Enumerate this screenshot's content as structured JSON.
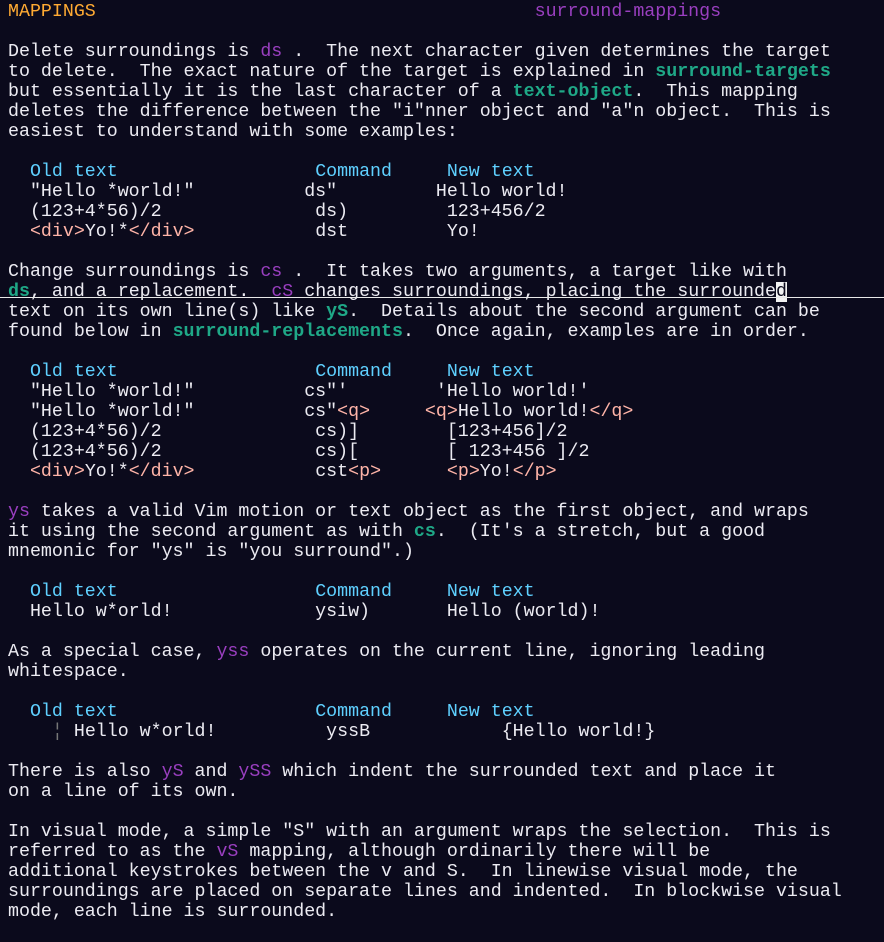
{
  "window": {
    "title": "MAPPINGS",
    "tag": "surround-mappings"
  },
  "colors": {
    "background": "#0b0a1c",
    "text": "#ecebf2",
    "heading": "#ffaa33",
    "tag": "#9a3fc0",
    "link": "#1fa887",
    "column_header": "#5fd0ff",
    "html_tag": "#ffb4a8"
  },
  "lines": [
    [
      {
        "t": "MAPPINGS",
        "s": "o"
      },
      {
        "t": "                                        "
      },
      {
        "t": "surround-mappings",
        "s": "p"
      }
    ],
    [],
    [
      {
        "t": "Delete surroundings is "
      },
      {
        "t": "ds",
        "s": "p"
      },
      {
        "t": " .  The next character given determines the target"
      }
    ],
    [
      {
        "t": "to delete.  The exact nature of the target is explained in "
      },
      {
        "t": "surround-targets",
        "s": "t"
      }
    ],
    [
      {
        "t": "but essentially it is the last character of a "
      },
      {
        "t": "text-object",
        "s": "t"
      },
      {
        "t": ".  This mapping"
      }
    ],
    [
      {
        "t": "deletes the difference between the \"i\"nner object and \"a\"n object.  This is"
      }
    ],
    [
      {
        "t": "easiest to understand with some examples:"
      }
    ],
    [],
    [
      {
        "t": "  "
      },
      {
        "t": "Old text",
        "s": "b"
      },
      {
        "t": "                  "
      },
      {
        "t": "Command",
        "s": "b"
      },
      {
        "t": "     "
      },
      {
        "t": "New text",
        "s": "b"
      }
    ],
    [
      {
        "t": "  \"Hello *world!\"          ds\"         Hello world!"
      }
    ],
    [
      {
        "t": "  (123+4*56)/2              ds)         123+456/2"
      }
    ],
    [
      {
        "t": "  "
      },
      {
        "t": "<div>",
        "s": "g"
      },
      {
        "t": "Yo!*"
      },
      {
        "t": "</div>",
        "s": "g"
      },
      {
        "t": "           dst         Yo!"
      }
    ],
    [],
    [
      {
        "t": "Change surroundings is "
      },
      {
        "t": "cs",
        "s": "p"
      },
      {
        "t": " .  It takes two arguments, a target like with"
      }
    ],
    [
      {
        "t": "ds",
        "s": "t"
      },
      {
        "t": ", and a replacement.  "
      },
      {
        "t": "cS",
        "s": "p"
      },
      {
        "t": " changes surroundings, placing the surrounde"
      },
      {
        "t": "d",
        "s": "c"
      }
    ],
    [
      {
        "t": "text on its own line(s) like "
      },
      {
        "t": "yS",
        "s": "t"
      },
      {
        "t": ".  Details about the second argument can be"
      }
    ],
    [
      {
        "t": "found below in "
      },
      {
        "t": "surround-replacements",
        "s": "t"
      },
      {
        "t": ".  Once again, examples are in order."
      }
    ],
    [],
    [
      {
        "t": "  "
      },
      {
        "t": "Old text",
        "s": "b"
      },
      {
        "t": "                  "
      },
      {
        "t": "Command",
        "s": "b"
      },
      {
        "t": "     "
      },
      {
        "t": "New text",
        "s": "b"
      }
    ],
    [
      {
        "t": "  \"Hello *world!\"          cs\"'        'Hello world!'"
      }
    ],
    [
      {
        "t": "  \"Hello *world!\"          cs\""
      },
      {
        "t": "<q>",
        "s": "g"
      },
      {
        "t": "     "
      },
      {
        "t": "<q>",
        "s": "g"
      },
      {
        "t": "Hello world!"
      },
      {
        "t": "</q>",
        "s": "g"
      }
    ],
    [
      {
        "t": "  (123+4*56)/2              cs)]        [123+456]/2"
      }
    ],
    [
      {
        "t": "  (123+4*56)/2              cs)[        [ 123+456 ]/2"
      }
    ],
    [
      {
        "t": "  "
      },
      {
        "t": "<div>",
        "s": "g"
      },
      {
        "t": "Yo!*"
      },
      {
        "t": "</div>",
        "s": "g"
      },
      {
        "t": "           cst"
      },
      {
        "t": "<p>",
        "s": "g"
      },
      {
        "t": "      "
      },
      {
        "t": "<p>",
        "s": "g"
      },
      {
        "t": "Yo!"
      },
      {
        "t": "</p>",
        "s": "g"
      }
    ],
    [],
    [
      {
        "t": "ys",
        "s": "p"
      },
      {
        "t": " takes a valid Vim motion or text object as the first object, and wraps"
      }
    ],
    [
      {
        "t": "it using the second argument as with "
      },
      {
        "t": "cs",
        "s": "t"
      },
      {
        "t": ".  (It's a stretch, but a good"
      }
    ],
    [
      {
        "t": "mnemonic for \"ys\" is \"you surround\".)"
      }
    ],
    [],
    [
      {
        "t": "  "
      },
      {
        "t": "Old text",
        "s": "b"
      },
      {
        "t": "                  "
      },
      {
        "t": "Command",
        "s": "b"
      },
      {
        "t": "     "
      },
      {
        "t": "New text",
        "s": "b"
      }
    ],
    [
      {
        "t": "  Hello w*orld!             ysiw)       Hello (world)!"
      }
    ],
    [],
    [
      {
        "t": "As a special case, "
      },
      {
        "t": "yss",
        "s": "p"
      },
      {
        "t": " operates on the current line, ignoring leading"
      }
    ],
    [
      {
        "t": "whitespace."
      }
    ],
    [],
    [
      {
        "t": "  "
      },
      {
        "t": "Old text",
        "s": "b"
      },
      {
        "t": "                  "
      },
      {
        "t": "Command",
        "s": "b"
      },
      {
        "t": "     "
      },
      {
        "t": "New text",
        "s": "b"
      }
    ],
    [
      {
        "t": "    "
      },
      {
        "t": "¦",
        "s": "bar"
      },
      {
        "t": " Hello w*orld!          yssB            {Hello world!}"
      }
    ],
    [],
    [
      {
        "t": "There is also "
      },
      {
        "t": "yS",
        "s": "p"
      },
      {
        "t": " and "
      },
      {
        "t": "ySS",
        "s": "p"
      },
      {
        "t": " which indent the surrounded text and place it"
      }
    ],
    [
      {
        "t": "on a line of its own."
      }
    ],
    [],
    [
      {
        "t": "In visual mode, a simple \"S\" with an argument wraps the selection.  This is"
      }
    ],
    [
      {
        "t": "referred to as the "
      },
      {
        "t": "vS",
        "s": "p"
      },
      {
        "t": " mapping, although ordinarily there will be"
      }
    ],
    [
      {
        "t": "additional keystrokes between the v and S.  In linewise visual mode, the"
      }
    ],
    [
      {
        "t": "surroundings are placed on separate lines and indented.  In blockwise visual"
      }
    ],
    [
      {
        "t": "mode, each line is surrounded."
      }
    ],
    []
  ],
  "cursor_line": 14
}
